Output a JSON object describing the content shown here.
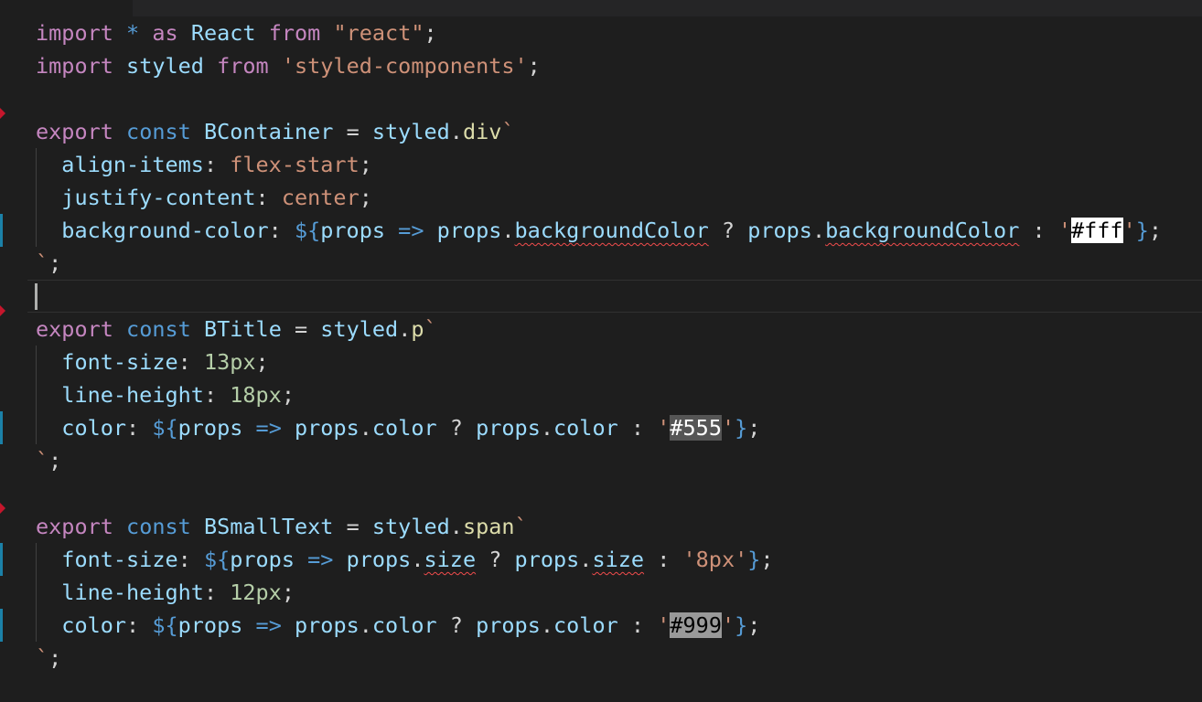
{
  "lines": [
    {
      "tokens": [
        {
          "c": "kw-ctrl",
          "t": "import"
        },
        {
          "c": "plain",
          "t": " "
        },
        {
          "c": "kw",
          "t": "*"
        },
        {
          "c": "plain",
          "t": " "
        },
        {
          "c": "kw-ctrl",
          "t": "as"
        },
        {
          "c": "plain",
          "t": " "
        },
        {
          "c": "var",
          "t": "React"
        },
        {
          "c": "plain",
          "t": " "
        },
        {
          "c": "kw-ctrl",
          "t": "from"
        },
        {
          "c": "plain",
          "t": " "
        },
        {
          "c": "str",
          "t": "\"react\""
        },
        {
          "c": "plain",
          "t": ";"
        }
      ]
    },
    {
      "tokens": [
        {
          "c": "kw-ctrl",
          "t": "import"
        },
        {
          "c": "plain",
          "t": " "
        },
        {
          "c": "var",
          "t": "styled"
        },
        {
          "c": "plain",
          "t": " "
        },
        {
          "c": "kw-ctrl",
          "t": "from"
        },
        {
          "c": "plain",
          "t": " "
        },
        {
          "c": "str",
          "t": "'styled-components'"
        },
        {
          "c": "plain",
          "t": ";"
        }
      ]
    },
    {
      "tokens": []
    },
    {
      "tokens": [
        {
          "c": "kw-ctrl",
          "t": "export"
        },
        {
          "c": "plain",
          "t": " "
        },
        {
          "c": "kw",
          "t": "const"
        },
        {
          "c": "plain",
          "t": " "
        },
        {
          "c": "var",
          "t": "BContainer"
        },
        {
          "c": "plain",
          "t": " = "
        },
        {
          "c": "var",
          "t": "styled"
        },
        {
          "c": "plain",
          "t": "."
        },
        {
          "c": "fn",
          "t": "div"
        },
        {
          "c": "str",
          "t": "`"
        }
      ]
    },
    {
      "indent": true,
      "tokens": [
        {
          "c": "plain",
          "t": "  "
        },
        {
          "c": "var",
          "t": "align-items"
        },
        {
          "c": "plain",
          "t": ": "
        },
        {
          "c": "str",
          "t": "flex-start"
        },
        {
          "c": "plain",
          "t": ";"
        }
      ]
    },
    {
      "indent": true,
      "tokens": [
        {
          "c": "plain",
          "t": "  "
        },
        {
          "c": "var",
          "t": "justify-content"
        },
        {
          "c": "plain",
          "t": ": "
        },
        {
          "c": "str",
          "t": "center"
        },
        {
          "c": "plain",
          "t": ";"
        }
      ]
    },
    {
      "indent": true,
      "tokens": [
        {
          "c": "plain",
          "t": "  "
        },
        {
          "c": "var",
          "t": "background-color"
        },
        {
          "c": "plain",
          "t": ": "
        },
        {
          "c": "tmpl",
          "t": "${"
        },
        {
          "c": "var",
          "t": "props"
        },
        {
          "c": "plain",
          "t": " "
        },
        {
          "c": "kw",
          "t": "=>"
        },
        {
          "c": "plain",
          "t": " "
        },
        {
          "c": "var",
          "t": "props"
        },
        {
          "c": "plain",
          "t": "."
        },
        {
          "c": "var squiggle",
          "t": "backgroundColor"
        },
        {
          "c": "plain",
          "t": " ? "
        },
        {
          "c": "var",
          "t": "props"
        },
        {
          "c": "plain",
          "t": "."
        },
        {
          "c": "var squiggle",
          "t": "backgroundColor"
        },
        {
          "c": "plain",
          "t": " : "
        },
        {
          "c": "str",
          "t": "'"
        },
        {
          "c": "swatch-white",
          "t": "#fff"
        },
        {
          "c": "str",
          "t": "'"
        },
        {
          "c": "tmpl",
          "t": "}"
        },
        {
          "c": "plain",
          "t": ";"
        }
      ]
    },
    {
      "tokens": [
        {
          "c": "str",
          "t": "`"
        },
        {
          "c": "plain",
          "t": ";"
        }
      ]
    },
    {
      "tokens": []
    },
    {
      "tokens": [
        {
          "c": "kw-ctrl",
          "t": "export"
        },
        {
          "c": "plain",
          "t": " "
        },
        {
          "c": "kw",
          "t": "const"
        },
        {
          "c": "plain",
          "t": " "
        },
        {
          "c": "var",
          "t": "BTitle"
        },
        {
          "c": "plain",
          "t": " = "
        },
        {
          "c": "var",
          "t": "styled"
        },
        {
          "c": "plain",
          "t": "."
        },
        {
          "c": "fn",
          "t": "p"
        },
        {
          "c": "str",
          "t": "`"
        }
      ]
    },
    {
      "indent": true,
      "tokens": [
        {
          "c": "plain",
          "t": "  "
        },
        {
          "c": "var",
          "t": "font-size"
        },
        {
          "c": "plain",
          "t": ": "
        },
        {
          "c": "num",
          "t": "13px"
        },
        {
          "c": "plain",
          "t": ";"
        }
      ]
    },
    {
      "indent": true,
      "tokens": [
        {
          "c": "plain",
          "t": "  "
        },
        {
          "c": "var",
          "t": "line-height"
        },
        {
          "c": "plain",
          "t": ": "
        },
        {
          "c": "num",
          "t": "18px"
        },
        {
          "c": "plain",
          "t": ";"
        }
      ]
    },
    {
      "indent": true,
      "tokens": [
        {
          "c": "plain",
          "t": "  "
        },
        {
          "c": "var",
          "t": "color"
        },
        {
          "c": "plain",
          "t": ": "
        },
        {
          "c": "tmpl",
          "t": "${"
        },
        {
          "c": "var",
          "t": "props"
        },
        {
          "c": "plain",
          "t": " "
        },
        {
          "c": "kw",
          "t": "=>"
        },
        {
          "c": "plain",
          "t": " "
        },
        {
          "c": "var",
          "t": "props"
        },
        {
          "c": "plain",
          "t": "."
        },
        {
          "c": "var",
          "t": "color"
        },
        {
          "c": "plain",
          "t": " ? "
        },
        {
          "c": "var",
          "t": "props"
        },
        {
          "c": "plain",
          "t": "."
        },
        {
          "c": "var",
          "t": "color"
        },
        {
          "c": "plain",
          "t": " : "
        },
        {
          "c": "str",
          "t": "'"
        },
        {
          "c": "swatch-555",
          "t": "#555"
        },
        {
          "c": "str",
          "t": "'"
        },
        {
          "c": "tmpl",
          "t": "}"
        },
        {
          "c": "plain",
          "t": ";"
        }
      ]
    },
    {
      "tokens": [
        {
          "c": "str",
          "t": "`"
        },
        {
          "c": "plain",
          "t": ";"
        }
      ]
    },
    {
      "tokens": []
    },
    {
      "tokens": [
        {
          "c": "kw-ctrl",
          "t": "export"
        },
        {
          "c": "plain",
          "t": " "
        },
        {
          "c": "kw",
          "t": "const"
        },
        {
          "c": "plain",
          "t": " "
        },
        {
          "c": "var",
          "t": "BSmallText"
        },
        {
          "c": "plain",
          "t": " = "
        },
        {
          "c": "var",
          "t": "styled"
        },
        {
          "c": "plain",
          "t": "."
        },
        {
          "c": "fn",
          "t": "span"
        },
        {
          "c": "str",
          "t": "`"
        }
      ]
    },
    {
      "indent": true,
      "tokens": [
        {
          "c": "plain",
          "t": "  "
        },
        {
          "c": "var",
          "t": "font-size"
        },
        {
          "c": "plain",
          "t": ": "
        },
        {
          "c": "tmpl",
          "t": "${"
        },
        {
          "c": "var",
          "t": "props"
        },
        {
          "c": "plain",
          "t": " "
        },
        {
          "c": "kw",
          "t": "=>"
        },
        {
          "c": "plain",
          "t": " "
        },
        {
          "c": "var",
          "t": "props"
        },
        {
          "c": "plain",
          "t": "."
        },
        {
          "c": "var squiggle",
          "t": "size"
        },
        {
          "c": "plain",
          "t": " ? "
        },
        {
          "c": "var",
          "t": "props"
        },
        {
          "c": "plain",
          "t": "."
        },
        {
          "c": "var squiggle",
          "t": "size"
        },
        {
          "c": "plain",
          "t": " : "
        },
        {
          "c": "str",
          "t": "'8px'"
        },
        {
          "c": "tmpl",
          "t": "}"
        },
        {
          "c": "plain",
          "t": ";"
        }
      ]
    },
    {
      "indent": true,
      "tokens": [
        {
          "c": "plain",
          "t": "  "
        },
        {
          "c": "var",
          "t": "line-height"
        },
        {
          "c": "plain",
          "t": ": "
        },
        {
          "c": "num",
          "t": "12px"
        },
        {
          "c": "plain",
          "t": ";"
        }
      ]
    },
    {
      "indent": true,
      "tokens": [
        {
          "c": "plain",
          "t": "  "
        },
        {
          "c": "var",
          "t": "color"
        },
        {
          "c": "plain",
          "t": ": "
        },
        {
          "c": "tmpl",
          "t": "${"
        },
        {
          "c": "var",
          "t": "props"
        },
        {
          "c": "plain",
          "t": " "
        },
        {
          "c": "kw",
          "t": "=>"
        },
        {
          "c": "plain",
          "t": " "
        },
        {
          "c": "var",
          "t": "props"
        },
        {
          "c": "plain",
          "t": "."
        },
        {
          "c": "var",
          "t": "color"
        },
        {
          "c": "plain",
          "t": " ? "
        },
        {
          "c": "var",
          "t": "props"
        },
        {
          "c": "plain",
          "t": "."
        },
        {
          "c": "var",
          "t": "color"
        },
        {
          "c": "plain",
          "t": " : "
        },
        {
          "c": "str",
          "t": "'"
        },
        {
          "c": "swatch-999",
          "t": "#999"
        },
        {
          "c": "str",
          "t": "'"
        },
        {
          "c": "tmpl",
          "t": "}"
        },
        {
          "c": "plain",
          "t": ";"
        }
      ]
    },
    {
      "tokens": [
        {
          "c": "str",
          "t": "`"
        },
        {
          "c": "plain",
          "t": ";"
        }
      ]
    }
  ],
  "colors": {
    "background": "#1e1e1e",
    "fold_marker": "#c5162c",
    "modified_bar": "#1b81a8"
  }
}
